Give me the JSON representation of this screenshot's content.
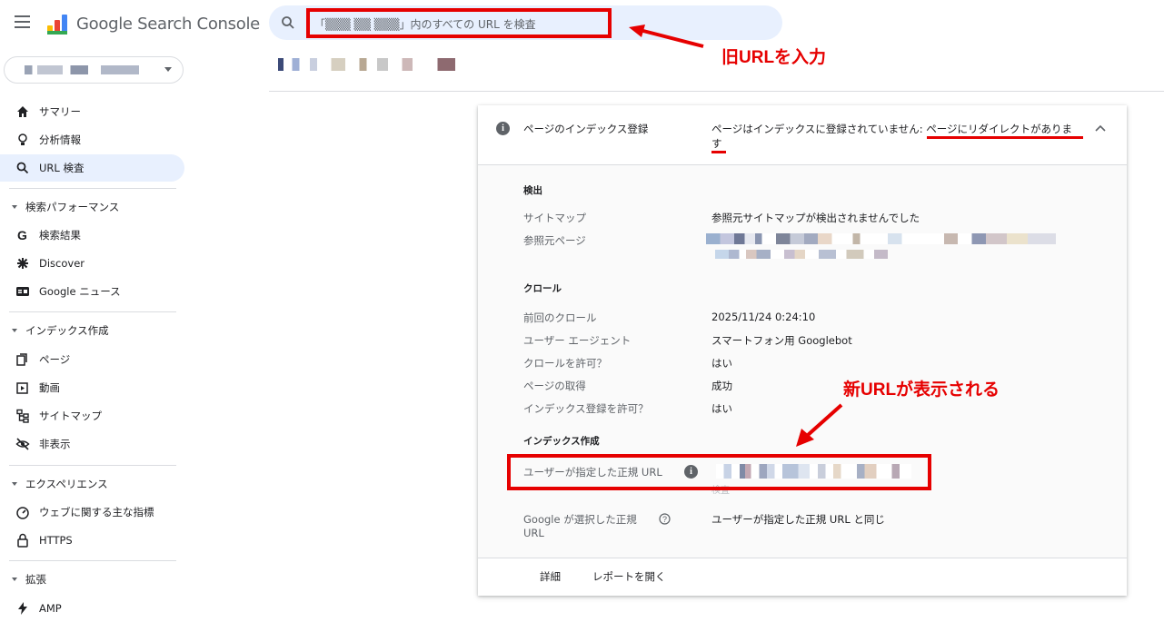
{
  "app": {
    "title": "Google Search Console"
  },
  "search": {
    "text": "「▒▒▒ ▒▒ ▒▒▒」内のすべての URL を検査"
  },
  "sidebar": {
    "top_items": [
      {
        "label": "サマリー"
      },
      {
        "label": "分析情報"
      },
      {
        "label": "URL 検査"
      }
    ],
    "sections": [
      {
        "title": "検索パフォーマンス",
        "items": [
          {
            "label": "検索結果"
          },
          {
            "label": "Discover"
          },
          {
            "label": "Google ニュース"
          }
        ]
      },
      {
        "title": "インデックス作成",
        "items": [
          {
            "label": "ページ"
          },
          {
            "label": "動画"
          },
          {
            "label": "サイトマップ"
          },
          {
            "label": "非表示"
          }
        ]
      },
      {
        "title": "エクスペリエンス",
        "items": [
          {
            "label": "ウェブに関する主な指標"
          },
          {
            "label": "HTTPS"
          }
        ]
      },
      {
        "title": "拡張",
        "items": [
          {
            "label": "AMP"
          }
        ]
      }
    ]
  },
  "card": {
    "header_label": "ページのインデックス登録",
    "status_prefix": "ページはインデックスに登録されていません: ",
    "status_reason_line1": "ページにリダイレクトがありま",
    "status_reason_line2": "す",
    "discovery": {
      "title": "検出",
      "sitemap_label": "サイトマップ",
      "sitemap_value": "参照元サイトマップが検出されませんでした",
      "referring_label": "参照元ページ"
    },
    "crawl": {
      "title": "クロール",
      "rows": [
        {
          "label": "前回のクロール",
          "value": "2025/11/24 0:24:10"
        },
        {
          "label": "ユーザー エージェント",
          "value": "スマートフォン用 Googlebot"
        },
        {
          "label": "クロールを許可？",
          "value": "はい"
        },
        {
          "label": "ページの取得",
          "value": "成功"
        },
        {
          "label": "インデックス登録を許可？",
          "value": "はい"
        }
      ]
    },
    "indexing": {
      "title": "インデックス作成",
      "user_canonical_label": "ユーザーが指定した正規 URL",
      "user_canonical_sub": "検査",
      "google_canonical_label_1": "Google が選択した正規",
      "google_canonical_label_2": "URL",
      "google_canonical_value": "ユーザーが指定した正規 URL と同じ"
    },
    "footer": {
      "details": "詳細",
      "open_report": "レポートを開く"
    }
  },
  "annotations": {
    "old_url": "旧URLを入力",
    "new_url": "新URLが表示される",
    "color": "#e60000"
  }
}
